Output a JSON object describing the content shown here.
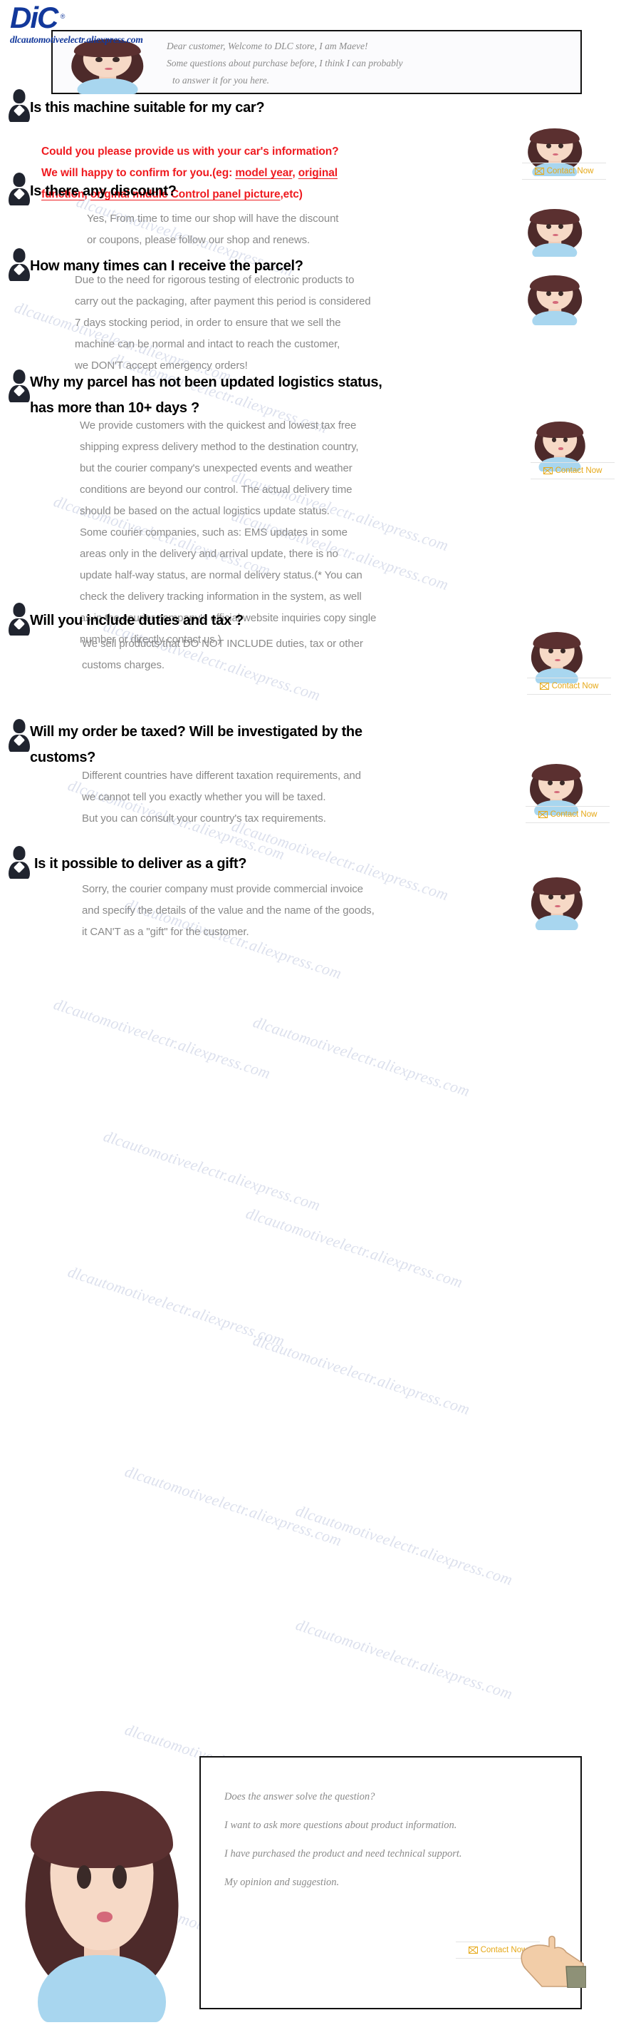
{
  "brand": {
    "logo_text": "DiC",
    "logo_registered": "®",
    "store_url": "dlcautomotiveelectr.aliexpress.com",
    "logo_color": "#12389b",
    "watermark_text": "dlcautomotiveelectr.aliexpress.com"
  },
  "intro": {
    "line1": "Dear customer, Welcome to DLC store, I am Maeve!",
    "line2": "Some questions about purchase before, I think I can probably",
    "line3": "to answer it for you here."
  },
  "contact": {
    "label": "Contact Now",
    "icon": "envelope-icon",
    "color": "#e6a817"
  },
  "faq": [
    {
      "id": "suitable",
      "question": "Is this machine suitable for my car?",
      "answer_lines": [
        "Could you please provide us with your car's information?",
        "We will happy to confirm for you.(eg: model year, original",
        "function, original middle Control panel picture,etc)"
      ],
      "answer_color": "#ef1b20",
      "has_contact": true,
      "avatar": "girl-hands-on-cheeks"
    },
    {
      "id": "discount",
      "question": "Is there any discount?",
      "answer_lines": [
        "Yes, From time to time our shop will have the discount",
        "or coupons, please follow our shop and renews."
      ],
      "answer_color": "#8a8a8a",
      "has_contact": false,
      "avatar": "girl-thinking"
    },
    {
      "id": "parcel-times",
      "question": "How many times can I receive the parcel?",
      "answer_lines": [
        "Due to the need for rigorous testing of electronic products to",
        "carry out the packaging, after payment this period is considered",
        "7 days stocking period, in order to ensure that we sell the",
        "machine can be normal and intact to reach the customer,",
        "we DON'T accept emergency orders!"
      ],
      "answer_color": "#8a8a8a",
      "has_contact": false,
      "avatar": "girl-hands-up"
    },
    {
      "id": "logistics-status",
      "question_lines": [
        "Why my parcel has not been updated logistics status,",
        "has more than 10+ days ?"
      ],
      "answer_lines": [
        "We provide customers with the quickest and lowest tax free",
        "shipping express delivery method to the destination country,",
        "but the courier company's unexpected events and weather",
        "conditions are beyond our control. The actual delivery time",
        "should be based on the actual logistics update status.",
        "Some courier companies, such as: EMS updates in some",
        "areas only in the delivery and arrival update, there is no",
        "update half-way status, are normal delivery status.(* You can",
        " check the delivery tracking information in the system, as well",
        "as in the courier company's official website inquiries copy single",
        " number or directly contact us.)"
      ],
      "answer_color": "#8a8a8a",
      "has_contact": true,
      "avatar": "girl-surprised"
    },
    {
      "id": "duties-tax",
      "question": "Will you include duties and tax ?",
      "answer_lines": [
        "We sell products that DO NOT INCLUDE duties, tax or other",
        "customs charges."
      ],
      "answer_color": "#8a8a8a",
      "has_contact": true,
      "avatar": "girl-sad"
    },
    {
      "id": "order-taxed",
      "question_lines": [
        "Will my order be taxed? Will be investigated by the",
        "customs?"
      ],
      "answer_lines": [
        "Different countries have different taxation requirements, and",
        " we cannot tell you exactly whether you will be taxed.",
        "But you can consult your country's tax requirements."
      ],
      "answer_color": "#8a8a8a",
      "has_contact": true,
      "avatar": "girl-victory-sign"
    },
    {
      "id": "gift-delivery",
      "question": "Is it possible to deliver as a gift?",
      "answer_lines": [
        "Sorry, the courier company must provide commercial invoice",
        "and specify the details of the value and the name of the goods,",
        "it CAN'T as a \"gift\" for the customer."
      ],
      "answer_color": "#8a8a8a",
      "has_contact": false,
      "avatar": "girl-sad2"
    }
  ],
  "footer": {
    "line1": "Does the answer solve the question?",
    "line2": "I want to ask more questions about product information.",
    "line3": "I have purchased the product and need technical support.",
    "line4": "My opinion and suggestion.",
    "contact_label": "Contact Now"
  }
}
